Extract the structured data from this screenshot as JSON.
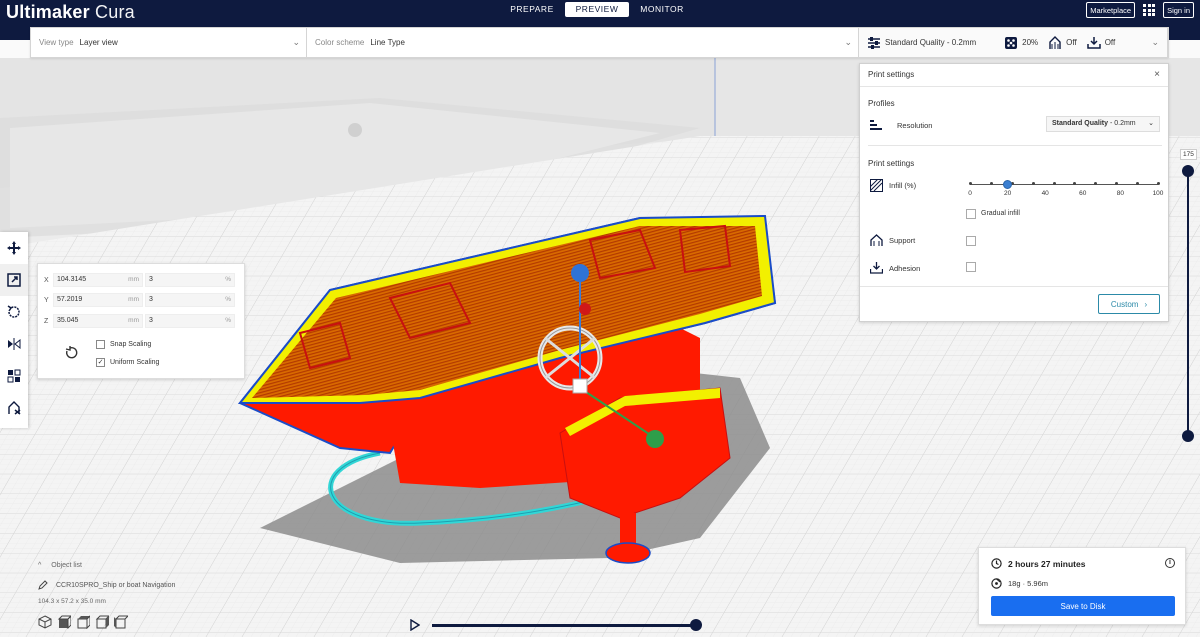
{
  "app": {
    "title_bold": "Ultimaker",
    "title_light": "Cura",
    "stages": [
      "PREPARE",
      "PREVIEW",
      "MONITOR"
    ],
    "active_stage": "PREVIEW",
    "marketplace_label": "Marketplace",
    "signin_label": "Sign in"
  },
  "options": {
    "view_type_label": "View type",
    "view_type_value": "Layer view",
    "color_scheme_label": "Color scheme",
    "color_scheme_value": "Line Type",
    "quality_value": "Standard Quality - 0.2mm",
    "infill_value": "20%",
    "support_value": "Off",
    "adhesion_value": "Off"
  },
  "scale": {
    "x_value": "104.3145",
    "y_value": "57.2019",
    "z_value": "35.045",
    "x_pct": "3",
    "y_pct": "3",
    "z_pct": "3",
    "unit_mm": "mm",
    "unit_pct": "%",
    "snap_label": "Snap Scaling",
    "uniform_label": "Uniform Scaling",
    "snap_checked": false,
    "uniform_checked": true
  },
  "print_settings": {
    "title": "Print settings",
    "profiles_heading": "Profiles",
    "resolution_label": "Resolution",
    "resolution_value": "Standard Quality",
    "resolution_suffix": " - 0.2mm",
    "settings_heading": "Print settings",
    "infill_label": "Infill (%)",
    "infill_value": 20,
    "ticks": [
      "0",
      "20",
      "40",
      "60",
      "80",
      "100"
    ],
    "gradual_label": "Gradual infill",
    "support_label": "Support",
    "adhesion_label": "Adhesion",
    "custom_label": "Custom"
  },
  "layer": {
    "current": "175"
  },
  "object": {
    "list_label": "Object list",
    "file_name": "CCR10SPRO_Ship or boat Navigation",
    "dimensions": "104.3 x 57.2 x 35.0 mm"
  },
  "estimate": {
    "time": "2 hours 27 minutes",
    "material": "18g · 5.96m",
    "save_label": "Save to Disk"
  },
  "colors": {
    "header_bg": "#0e1a3f",
    "accent": "#196ef0",
    "model_wall": "#ff1a00",
    "model_top": "#f2f000",
    "support": "#32d6d6"
  }
}
